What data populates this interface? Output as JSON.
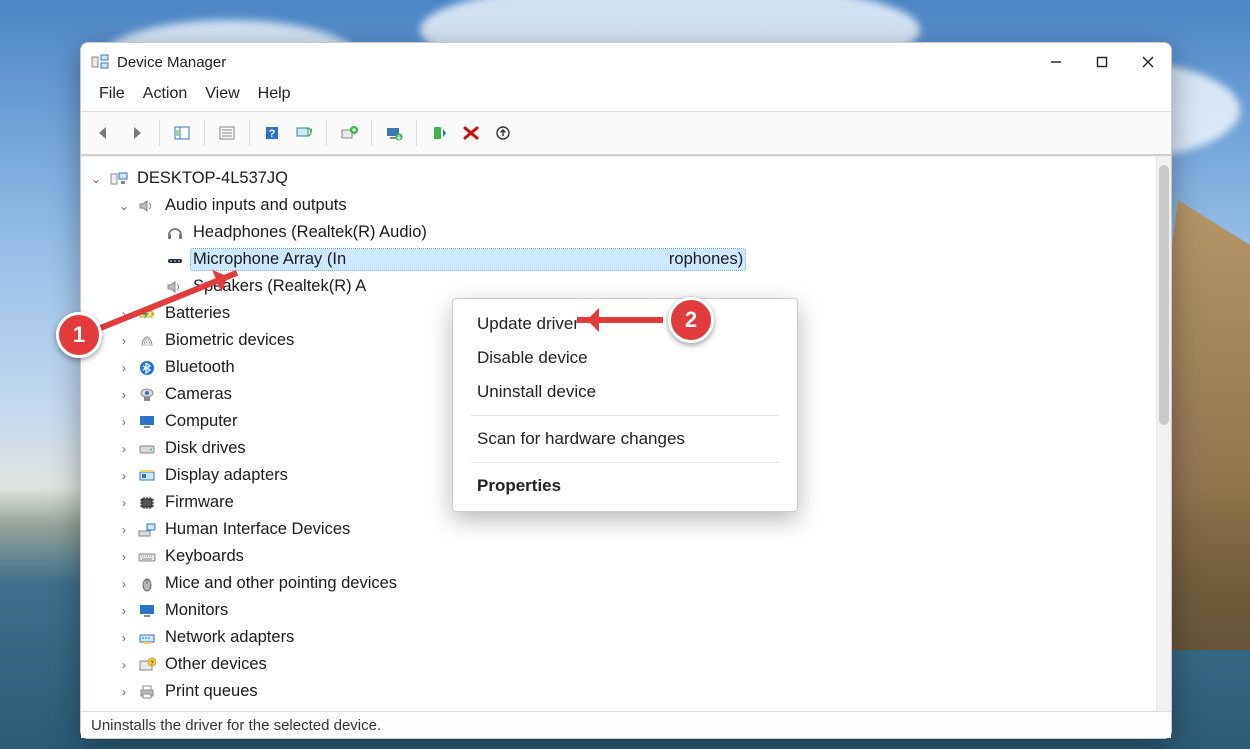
{
  "titlebar": {
    "title": "Device Manager"
  },
  "menus": {
    "file": "File",
    "action": "Action",
    "view": "View",
    "help": "Help"
  },
  "tree": {
    "root": "DESKTOP-4L537JQ",
    "audio_label": "Audio inputs and outputs",
    "audio_children": {
      "headphones": "Headphones (Realtek(R) Audio)",
      "mic_full": "Microphone Array (Intel® Smart Sound Technology for Digital Microphones)",
      "mic_left": "Microphone Array (In",
      "mic_right": "rophones)",
      "speakers": "Speakers (Realtek(R) A"
    },
    "cats": [
      "Batteries",
      "Biometric devices",
      "Bluetooth",
      "Cameras",
      "Computer",
      "Disk drives",
      "Display adapters",
      "Firmware",
      "Human Interface Devices",
      "Keyboards",
      "Mice and other pointing devices",
      "Monitors",
      "Network adapters",
      "Other devices",
      "Print queues"
    ]
  },
  "context": {
    "update": "Update driver",
    "disable": "Disable device",
    "uninstall": "Uninstall device",
    "scan": "Scan for hardware changes",
    "props": "Properties"
  },
  "status": "Uninstalls the driver for the selected device.",
  "annotations": {
    "one": "1",
    "two": "2"
  }
}
